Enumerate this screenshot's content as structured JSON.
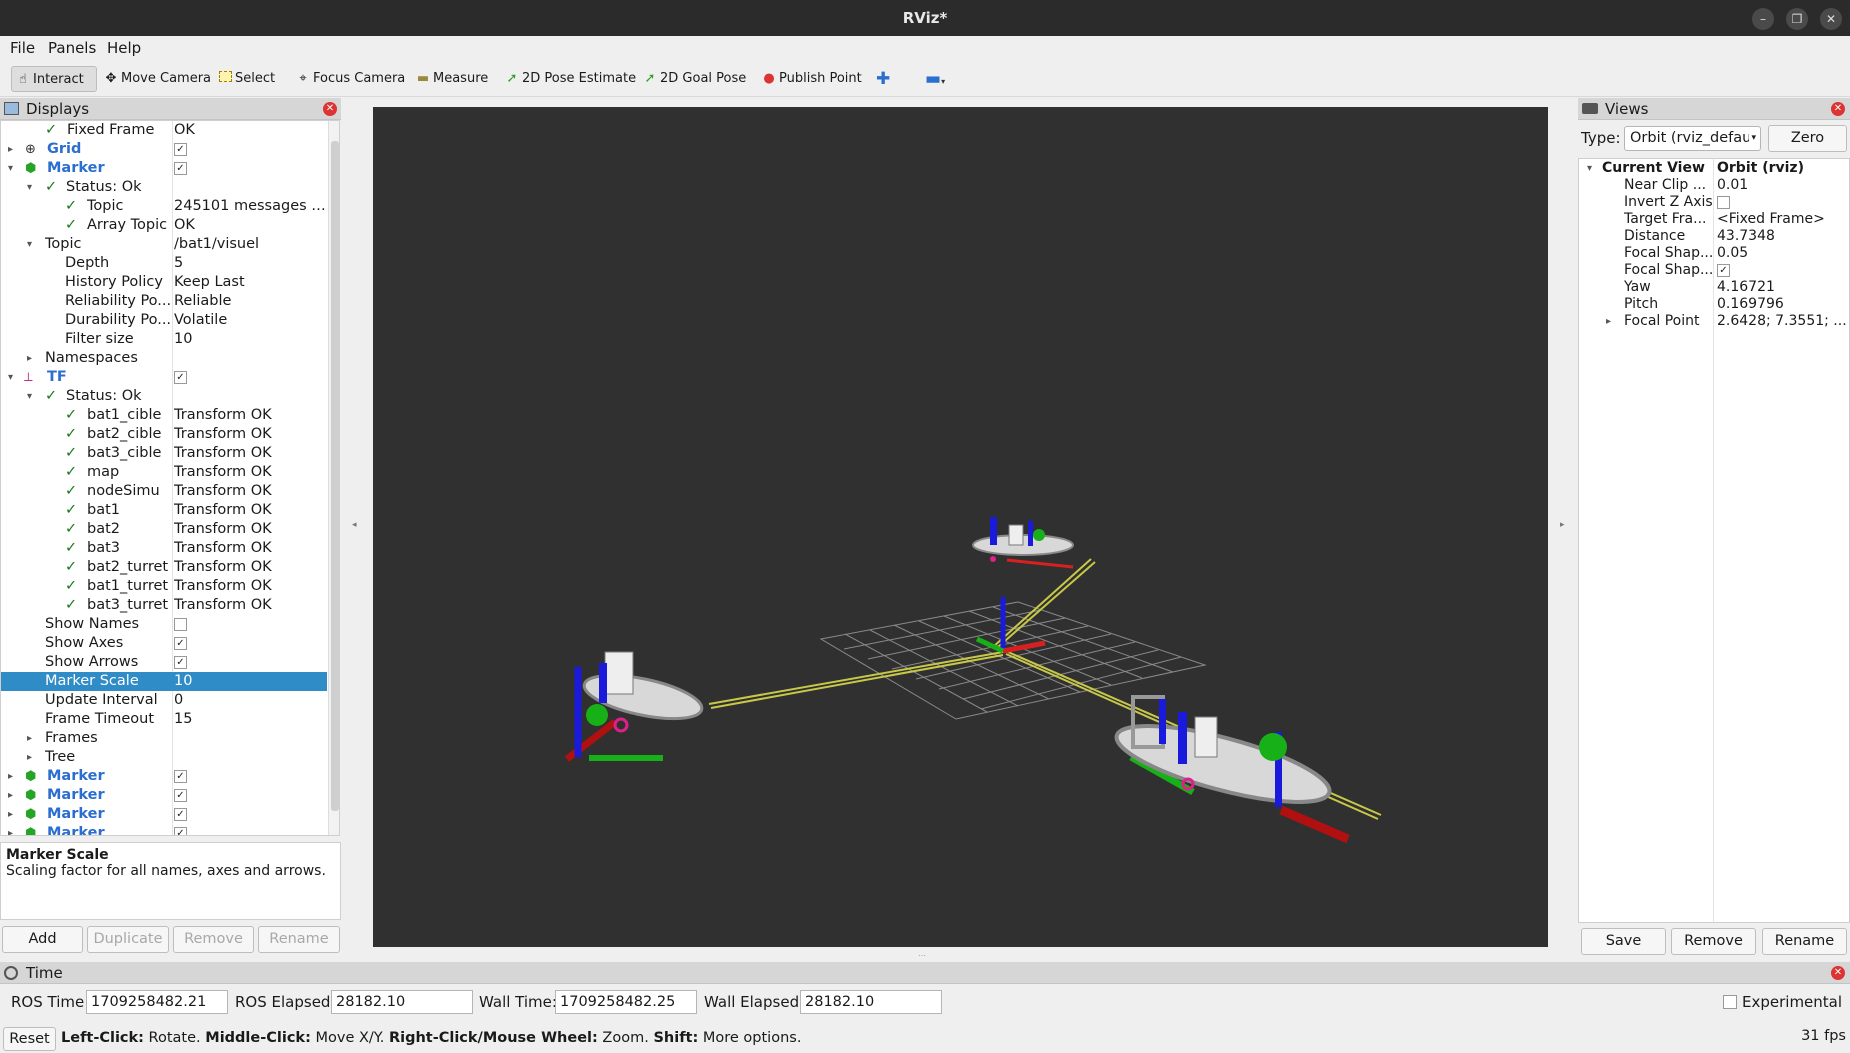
{
  "window": {
    "title": "RViz*"
  },
  "menu": [
    "File",
    "Panels",
    "Help"
  ],
  "toolbar": [
    {
      "label": "Interact",
      "icon": "hand-icon"
    },
    {
      "label": "Move Camera",
      "icon": "move-camera-icon"
    },
    {
      "label": "Select",
      "icon": "select-icon"
    },
    {
      "label": "Focus Camera",
      "icon": "focus-camera-icon"
    },
    {
      "label": "Measure",
      "icon": "measure-icon"
    },
    {
      "label": "2D Pose Estimate",
      "icon": "pose-arrow-icon"
    },
    {
      "label": "2D Goal Pose",
      "icon": "goal-arrow-icon"
    },
    {
      "label": "Publish Point",
      "icon": "map-pin-icon"
    }
  ],
  "displays": {
    "title": "Displays",
    "rows": [
      {
        "name": "Fixed Frame",
        "value": "OK"
      },
      {
        "name": "Grid",
        "value": ""
      },
      {
        "name": "Marker",
        "value": ""
      },
      {
        "name": "Status: Ok",
        "value": ""
      },
      {
        "name": "Topic",
        "value": "245101 messages rec..."
      },
      {
        "name": "Array Topic",
        "value": "OK"
      },
      {
        "name": "Topic",
        "value": "/bat1/visuel"
      },
      {
        "name": "Depth",
        "value": "5"
      },
      {
        "name": "History Policy",
        "value": "Keep Last"
      },
      {
        "name": "Reliability Po...",
        "value": "Reliable"
      },
      {
        "name": "Durability Po...",
        "value": "Volatile"
      },
      {
        "name": "Filter size",
        "value": "10"
      },
      {
        "name": "Namespaces",
        "value": ""
      },
      {
        "name": "TF",
        "value": ""
      },
      {
        "name": "Status: Ok",
        "value": ""
      },
      {
        "name": "bat1_cible",
        "value": "Transform OK"
      },
      {
        "name": "bat2_cible",
        "value": "Transform OK"
      },
      {
        "name": "bat3_cible",
        "value": "Transform OK"
      },
      {
        "name": "map",
        "value": "Transform OK"
      },
      {
        "name": "nodeSimu",
        "value": "Transform OK"
      },
      {
        "name": "bat1",
        "value": "Transform OK"
      },
      {
        "name": "bat2",
        "value": "Transform OK"
      },
      {
        "name": "bat3",
        "value": "Transform OK"
      },
      {
        "name": "bat2_turret",
        "value": "Transform OK"
      },
      {
        "name": "bat1_turret",
        "value": "Transform OK"
      },
      {
        "name": "bat3_turret",
        "value": "Transform OK"
      },
      {
        "name": "Show Names",
        "value": ""
      },
      {
        "name": "Show Axes",
        "value": ""
      },
      {
        "name": "Show Arrows",
        "value": ""
      },
      {
        "name": "Marker Scale",
        "value": "10"
      },
      {
        "name": "Update Interval",
        "value": "0"
      },
      {
        "name": "Frame Timeout",
        "value": "15"
      },
      {
        "name": "Frames",
        "value": ""
      },
      {
        "name": "Tree",
        "value": ""
      },
      {
        "name": "Marker",
        "value": ""
      },
      {
        "name": "Marker",
        "value": ""
      },
      {
        "name": "Marker",
        "value": ""
      },
      {
        "name": "Marker",
        "value": ""
      }
    ],
    "description_title": "Marker Scale",
    "description_text": "Scaling factor for all names, axes and arrows.",
    "buttons": {
      "add": "Add",
      "duplicate": "Duplicate",
      "remove": "Remove",
      "rename": "Rename"
    }
  },
  "views": {
    "title": "Views",
    "type_label": "Type:",
    "type_value": "Orbit (rviz_defau",
    "zero_button": "Zero",
    "rows": [
      {
        "name": "Current View",
        "value": "Orbit (rviz)"
      },
      {
        "name": "Near Clip ...",
        "value": "0.01"
      },
      {
        "name": "Invert Z Axis",
        "value": ""
      },
      {
        "name": "Target Fra...",
        "value": "<Fixed Frame>"
      },
      {
        "name": "Distance",
        "value": "43.7348"
      },
      {
        "name": "Focal Shap...",
        "value": "0.05"
      },
      {
        "name": "Focal Shap...",
        "value": ""
      },
      {
        "name": "Yaw",
        "value": "4.16721"
      },
      {
        "name": "Pitch",
        "value": "0.169796"
      },
      {
        "name": "Focal Point",
        "value": "2.6428; 7.3551; ..."
      }
    ],
    "buttons": {
      "save": "Save",
      "remove": "Remove",
      "rename": "Rename"
    }
  },
  "time": {
    "title": "Time",
    "ros_time_label": "ROS Time:",
    "ros_time": "1709258482.21",
    "ros_elapsed_label": "ROS Elapsed:",
    "ros_elapsed": "28182.10",
    "wall_time_label": "Wall Time:",
    "wall_time": "1709258482.25",
    "wall_elapsed_label": "Wall Elapsed:",
    "wall_elapsed": "28182.10",
    "experimental_label": "Experimental"
  },
  "status": {
    "reset": "Reset",
    "hint_left_b": "Left-Click:",
    "hint_left": " Rotate. ",
    "hint_mid_b": "Middle-Click:",
    "hint_mid": " Move X/Y. ",
    "hint_right_b": "Right-Click/Mouse Wheel:",
    "hint_right": " Zoom. ",
    "hint_shift_b": "Shift:",
    "hint_shift": " More options.",
    "fps": "31 fps"
  }
}
